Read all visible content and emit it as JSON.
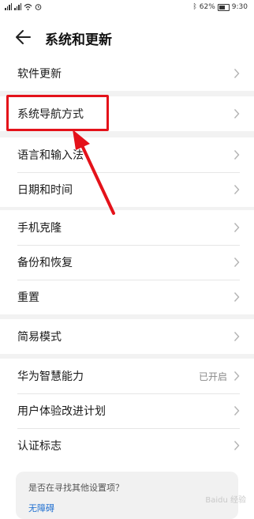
{
  "status": {
    "left_text": "4G 4G",
    "battery": "62%",
    "time": "9:30"
  },
  "header": {
    "title": "系统和更新"
  },
  "groups": [
    {
      "items": [
        {
          "label": "软件更新"
        }
      ]
    },
    {
      "items": [
        {
          "label": "系统导航方式"
        }
      ]
    },
    {
      "items": [
        {
          "label": "语言和输入法"
        },
        {
          "label": "日期和时间"
        }
      ]
    },
    {
      "items": [
        {
          "label": "手机克隆"
        },
        {
          "label": "备份和恢复"
        },
        {
          "label": "重置"
        }
      ]
    },
    {
      "items": [
        {
          "label": "简易模式"
        }
      ]
    },
    {
      "items": [
        {
          "label": "华为智慧能力",
          "value": "已开启"
        },
        {
          "label": "用户体验改进计划"
        },
        {
          "label": "认证标志"
        }
      ]
    }
  ],
  "suggestion": {
    "question": "是否在寻找其他设置项？",
    "link": "无障碍"
  },
  "annotation": {
    "highlight_color": "#e4121a"
  },
  "watermark": "Baidu 经验"
}
